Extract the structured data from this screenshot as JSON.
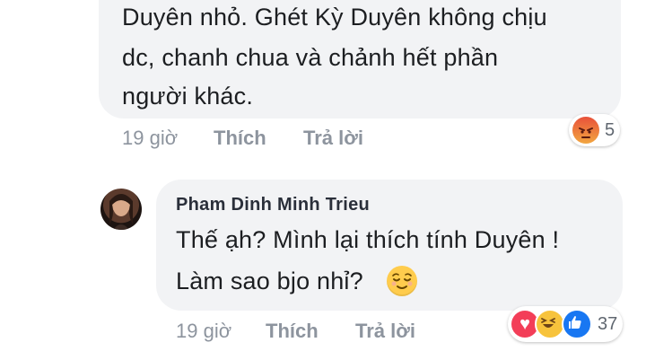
{
  "comment1": {
    "lines": [
      "Duyên nhỏ. Ghét Kỳ Duyên không chịu",
      "dc, chanh chua và chảnh hết phần",
      "người khác."
    ],
    "time": "19 giờ",
    "like_label": "Thích",
    "reply_label": "Trả lời",
    "reaction_count": "5",
    "reaction_icons": [
      "angry-icon"
    ]
  },
  "comment2": {
    "author": "Pham Dinh Minh Trieu",
    "lines": [
      "Thế ạh? Mình lại thích tính Duyên !",
      "Làm sao bjo nhỉ?"
    ],
    "emoji": "relieved-face-icon",
    "time": "19 giờ",
    "like_label": "Thích",
    "reply_label": "Trả lời",
    "reaction_count": "37",
    "reaction_icons": [
      "love-icon",
      "haha-icon",
      "like-icon"
    ]
  },
  "colors": {
    "bubble": "#f2f3f5",
    "meta_text": "#8d949e",
    "like_blue": "#1877f2",
    "love_red": "#f33e58",
    "haha_yellow": "#f7c33c"
  }
}
